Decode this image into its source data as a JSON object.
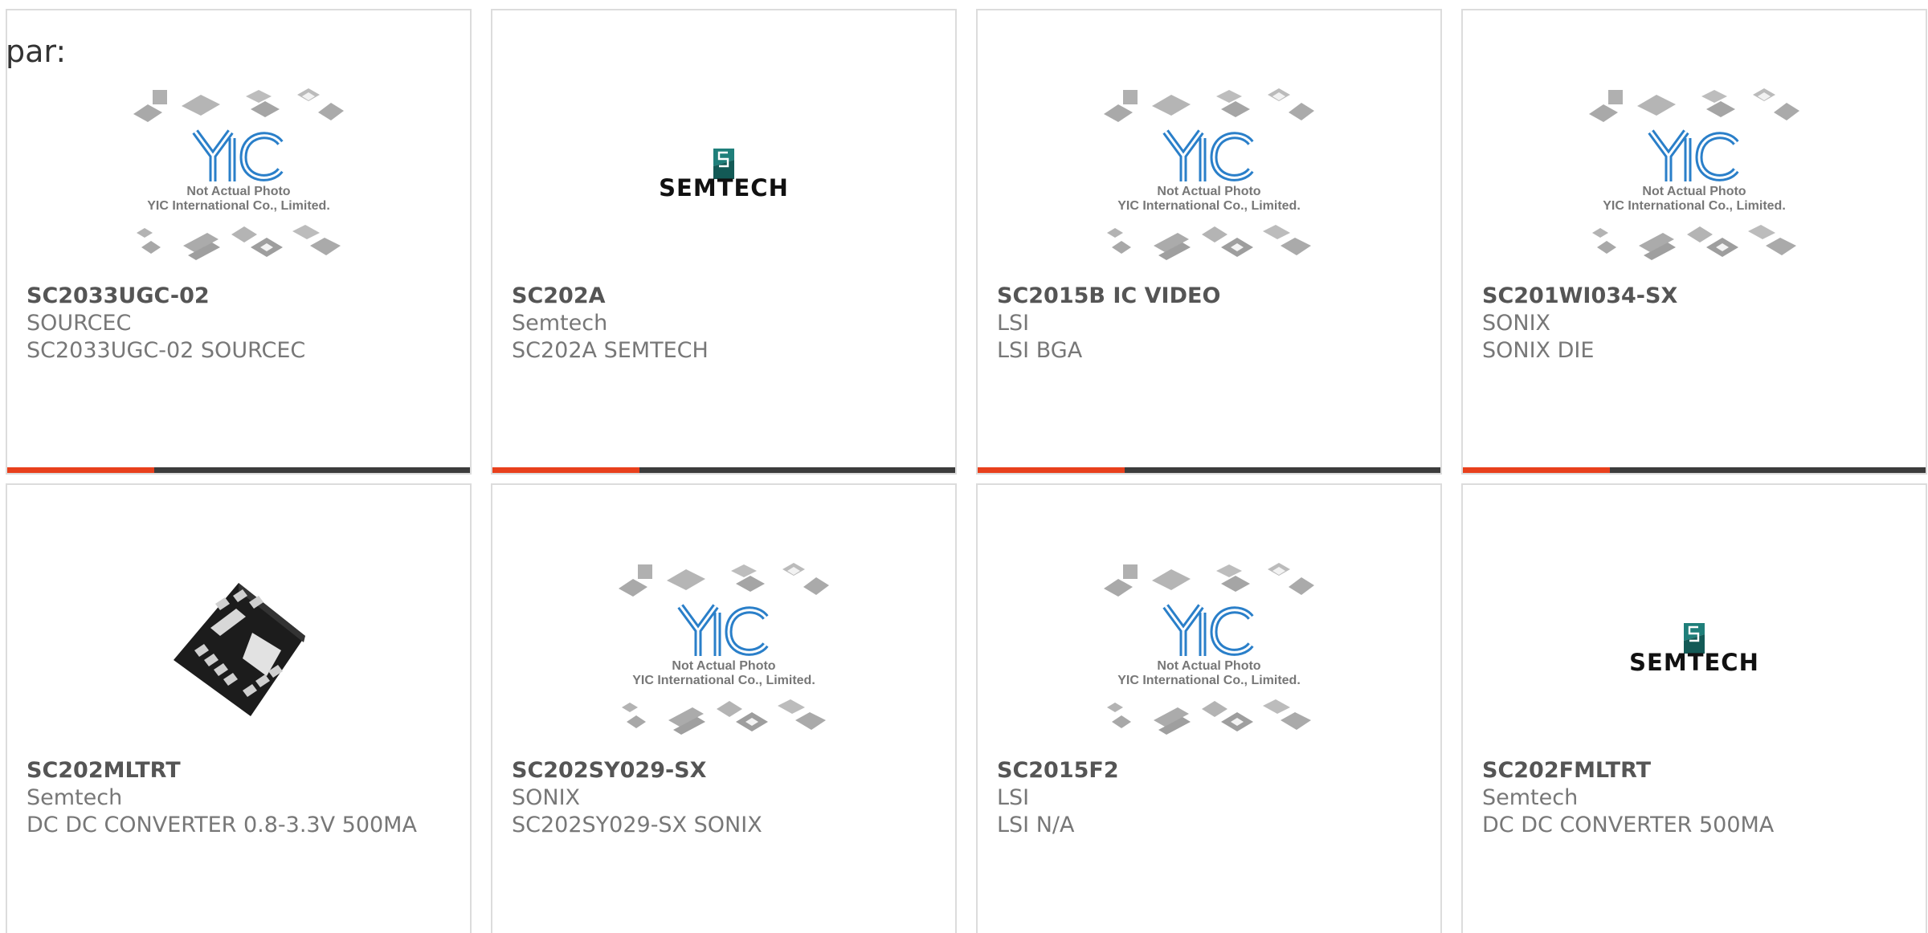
{
  "page": {
    "label": "par:"
  },
  "colors": {
    "accent": "#e8401c",
    "bar": "#3c3c3c",
    "border": "#dcdcdc",
    "yic_blue": "#2a7fc9"
  },
  "placeholder": {
    "line1": "Not Actual Photo",
    "line2": "YIC International Co., Limited."
  },
  "semtech_logo_text": "SEMTECH",
  "products": [
    {
      "part": "SC2033UGC-02",
      "maker": "SOURCEC",
      "desc": "SC2033UGC-02 SOURCEC",
      "image": "yic-placeholder"
    },
    {
      "part": "SC202A",
      "maker": "Semtech",
      "desc": "SC202A SEMTECH",
      "image": "semtech-logo"
    },
    {
      "part": "SC2015B IC VIDEO",
      "maker": "LSI",
      "desc": "LSI BGA",
      "image": "yic-placeholder"
    },
    {
      "part": "SC201WI034-SX",
      "maker": "SONIX",
      "desc": "SONIX DIE",
      "image": "yic-placeholder"
    },
    {
      "part": "SC202MLTRT",
      "maker": "Semtech",
      "desc": "DC DC CONVERTER 0.8-3.3V 500MA",
      "image": "chip-photo"
    },
    {
      "part": "SC202SY029-SX",
      "maker": "SONIX",
      "desc": "SC202SY029-SX SONIX",
      "image": "yic-placeholder"
    },
    {
      "part": "SC2015F2",
      "maker": "LSI",
      "desc": "LSI N/A",
      "image": "yic-placeholder"
    },
    {
      "part": "SC202FMLTRT",
      "maker": "Semtech",
      "desc": "DC DC CONVERTER 500MA",
      "image": "semtech-logo"
    }
  ]
}
